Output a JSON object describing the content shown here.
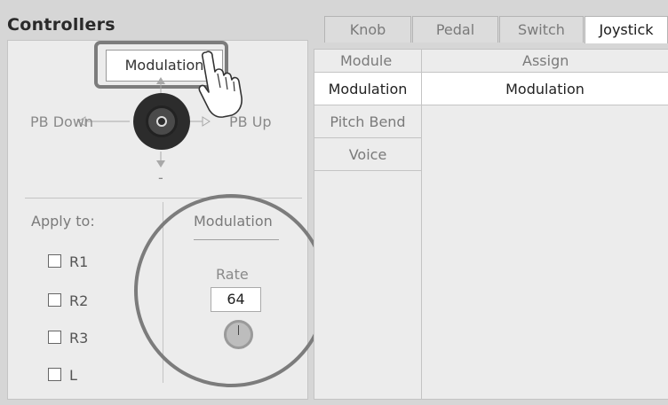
{
  "header": {
    "title": "Controllers"
  },
  "tabs": [
    {
      "label": "Knob",
      "active": false
    },
    {
      "label": "Pedal",
      "active": false
    },
    {
      "label": "Switch",
      "active": false
    },
    {
      "label": "Joystick",
      "active": true
    }
  ],
  "joystick_panel": {
    "assign_button_label": "Modulation",
    "pb_down_label": "PB Down",
    "pb_up_label": "PB Up",
    "minus_label": "-"
  },
  "apply_to": {
    "label": "Apply to:",
    "parts": [
      {
        "label": "R1",
        "checked": false
      },
      {
        "label": "R2",
        "checked": false
      },
      {
        "label": "R3",
        "checked": false
      },
      {
        "label": "L",
        "checked": false
      }
    ]
  },
  "modulation_settings": {
    "heading": "Modulation",
    "rate_label": "Rate",
    "rate_value": "64"
  },
  "assign_table": {
    "module_header": "Module",
    "assign_header": "Assign",
    "modules": [
      {
        "label": "Modulation",
        "selected": true
      },
      {
        "label": "Pitch Bend",
        "selected": false
      },
      {
        "label": "Voice",
        "selected": false
      }
    ],
    "assign_value": "Modulation"
  },
  "colors": {
    "background": "#d6d6d6",
    "panel": "#ececec",
    "highlight_outline": "#7c7c7c",
    "joystick": "#2c2c2c"
  }
}
